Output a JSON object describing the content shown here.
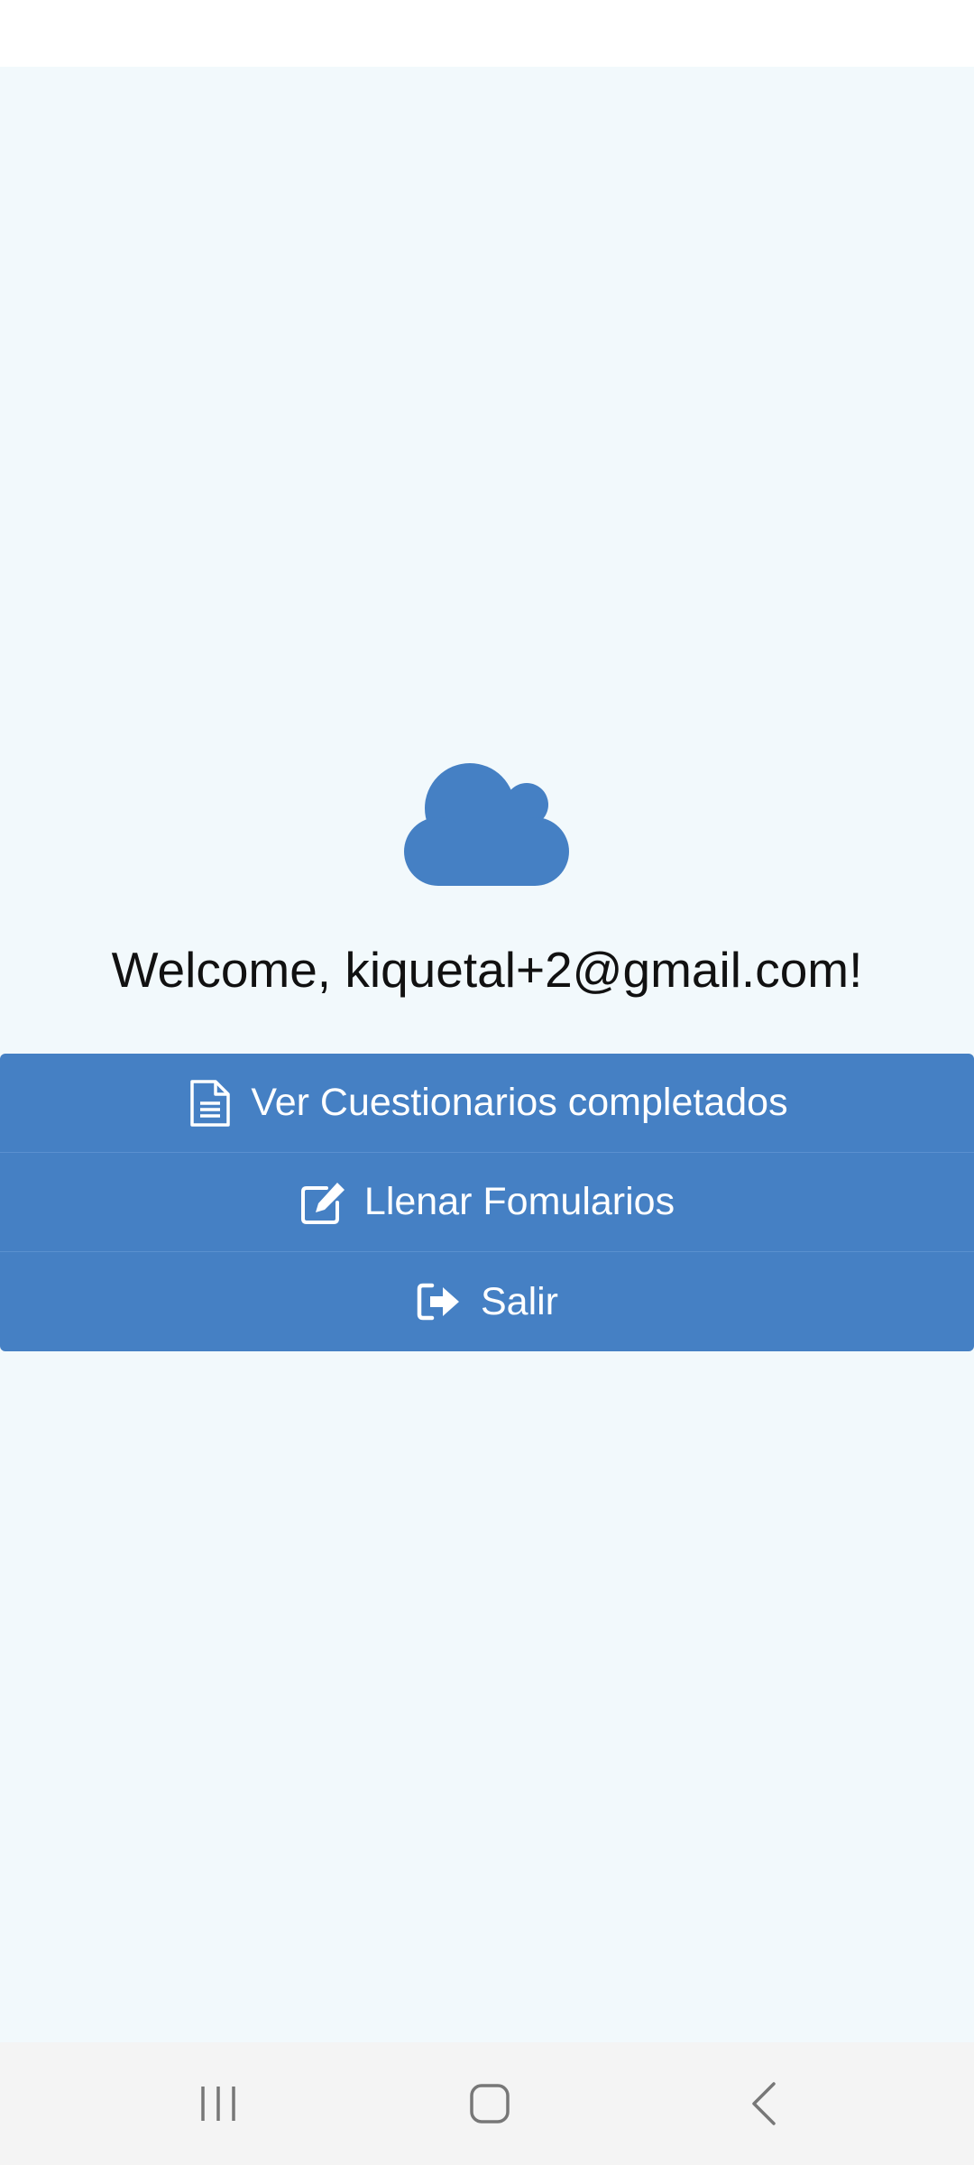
{
  "welcome": {
    "text": "Welcome, kiquetal+2@gmail.com!"
  },
  "menu": {
    "items": [
      {
        "label": "Ver Cuestionarios completados",
        "icon": "document-icon"
      },
      {
        "label": "Llenar Fomularios",
        "icon": "edit-icon"
      },
      {
        "label": "Salir",
        "icon": "sign-out-icon"
      }
    ]
  },
  "colors": {
    "background": "#f2f9fc",
    "accent": "#4580c4",
    "text": "#111111",
    "nav_bar": "#f4f4f4"
  },
  "icons": {
    "logo": "cloud-icon",
    "nav": [
      "recent-apps-icon",
      "home-icon",
      "back-icon"
    ]
  }
}
